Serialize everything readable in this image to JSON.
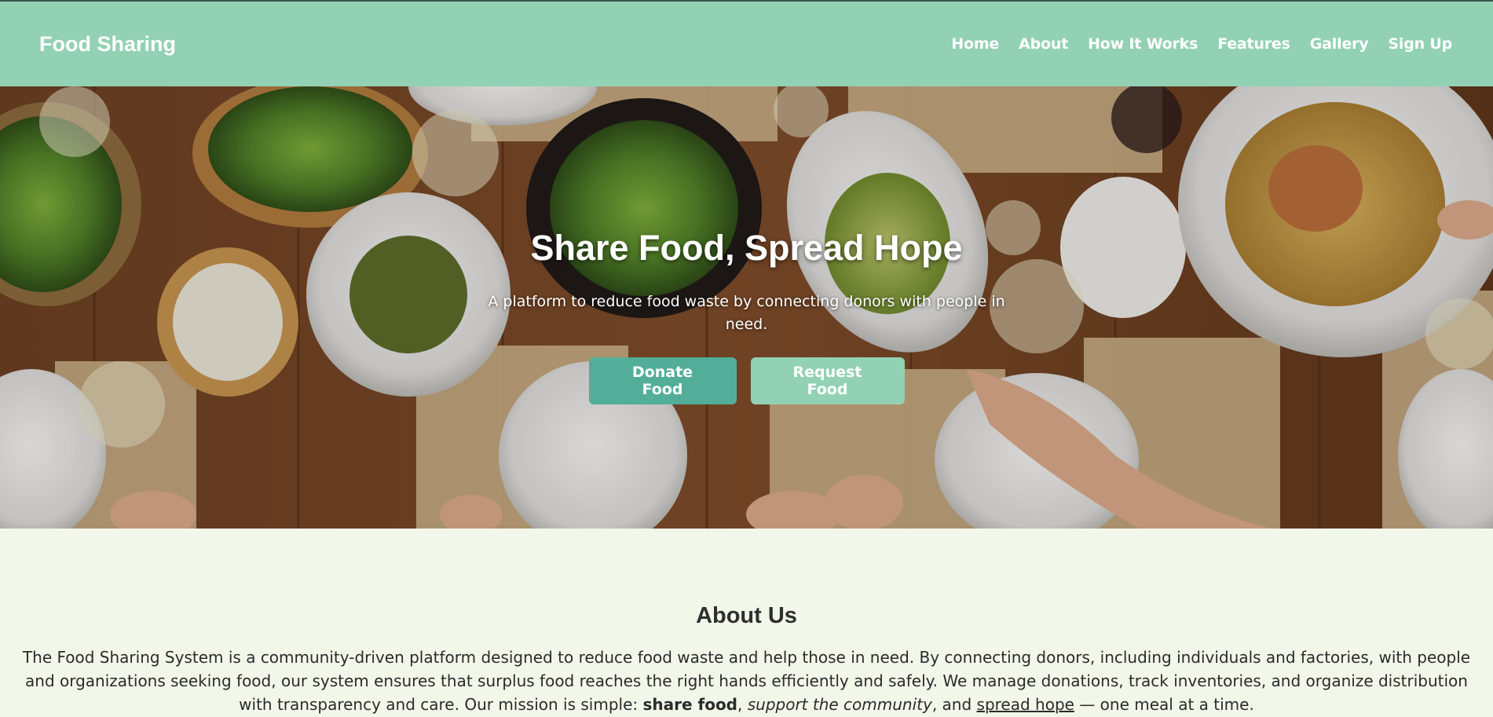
{
  "navbar": {
    "brand": "Food Sharing",
    "links": [
      "Home",
      "About",
      "How It Works",
      "Features",
      "Gallery",
      "Sign Up"
    ]
  },
  "hero": {
    "title": "Share Food, Spread Hope",
    "subtitle": "A platform to reduce food waste by connecting donors with people in need.",
    "donate_label": "Donate Food",
    "request_label": "Request Food"
  },
  "about": {
    "title": "About Us",
    "text_intro": "The Food Sharing System is a community-driven platform designed to reduce food waste and help those in need. By connecting donors, including individuals and factories, with people and organizations seeking food, our system ensures that surplus food reaches the right hands efficiently and safely. We manage donations, track inventories, and organize distribution with transparency and care. Our mission is simple: ",
    "text_bold": "share food",
    "text_sep1": ", ",
    "text_italic": "support the community",
    "text_sep2": ", and ",
    "text_underline": "spread hope",
    "text_outro": " — one meal at a time."
  },
  "colors": {
    "navbar_bg": "#93d1b4",
    "donate_button": "#52ae98",
    "request_button": "#93d1b4",
    "page_bg": "#f1f8e9"
  }
}
